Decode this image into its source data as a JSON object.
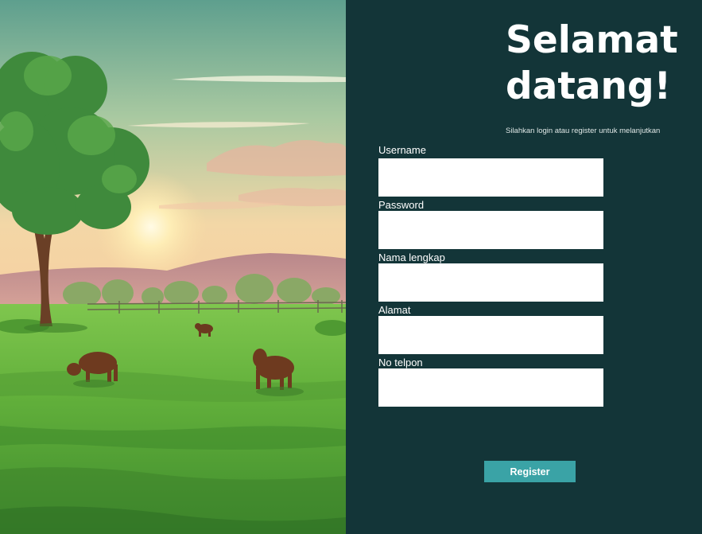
{
  "welcome": {
    "title": "Selamat datang!",
    "subtitle": "Silahkan login atau register untuk melanjutkan"
  },
  "form": {
    "fields": [
      {
        "label": "Username",
        "value": ""
      },
      {
        "label": "Password",
        "value": ""
      },
      {
        "label": "Nama lengkap",
        "value": ""
      },
      {
        "label": "Alamat",
        "value": ""
      },
      {
        "label": "No telpon",
        "value": ""
      }
    ],
    "submit_label": "Register"
  },
  "colors": {
    "panel_background": "#133538",
    "button_accent": "#3aa3a6",
    "text": "#ffffff"
  }
}
